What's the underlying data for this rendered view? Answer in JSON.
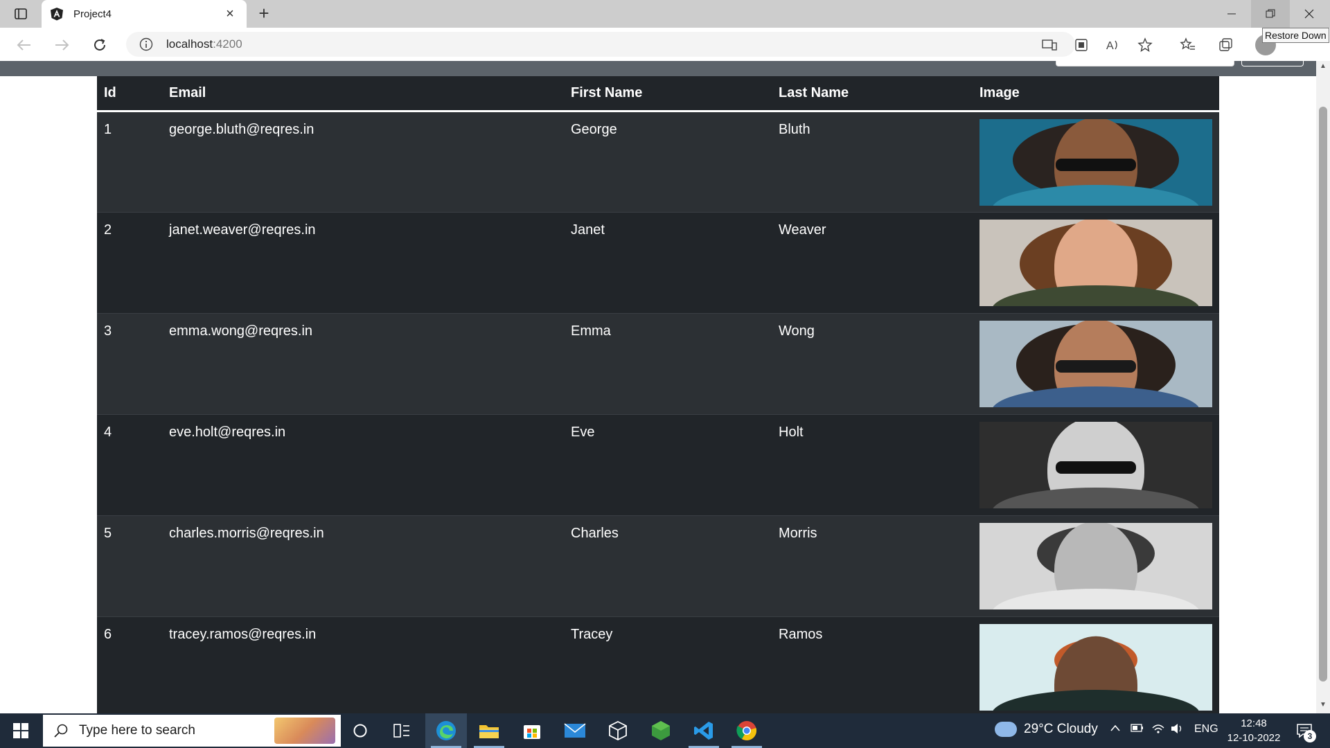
{
  "browser": {
    "tab_title": "Project4",
    "address_host": "localhost",
    "address_port": ":4200",
    "tooltip": "Restore Down"
  },
  "table": {
    "headers": {
      "id": "Id",
      "email": "Email",
      "first_name": "First Name",
      "last_name": "Last Name",
      "image": "Image"
    },
    "rows": [
      {
        "id": "1",
        "email": "george.bluth@reqres.in",
        "first_name": "George",
        "last_name": "Bluth"
      },
      {
        "id": "2",
        "email": "janet.weaver@reqres.in",
        "first_name": "Janet",
        "last_name": "Weaver"
      },
      {
        "id": "3",
        "email": "emma.wong@reqres.in",
        "first_name": "Emma",
        "last_name": "Wong"
      },
      {
        "id": "4",
        "email": "eve.holt@reqres.in",
        "first_name": "Eve",
        "last_name": "Holt"
      },
      {
        "id": "5",
        "email": "charles.morris@reqres.in",
        "first_name": "Charles",
        "last_name": "Morris"
      },
      {
        "id": "6",
        "email": "tracey.ramos@reqres.in",
        "first_name": "Tracey",
        "last_name": "Ramos"
      }
    ]
  },
  "taskbar": {
    "search_placeholder": "Type here to search",
    "weather": "29°C  Cloudy",
    "language": "ENG",
    "time": "12:48",
    "date": "12-10-2022",
    "notification_count": "3"
  },
  "colors": {
    "table_dark": "#212529",
    "table_striped": "#2c3034",
    "navbar": "#5c636a",
    "taskbar": "#1f2b3a"
  }
}
